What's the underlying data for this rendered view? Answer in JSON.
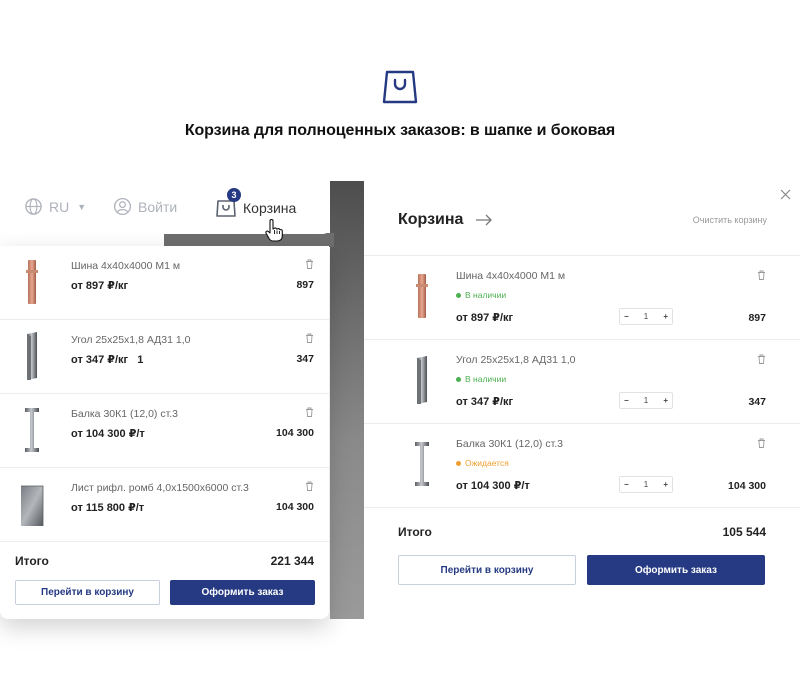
{
  "hero": {
    "icon": "shopping-bag-icon",
    "title": "Корзина для полноценных заказов: в шапке и боковая"
  },
  "colors": {
    "accent": "#253a82",
    "in_stock": "#4caf50",
    "expected": "#f0a030"
  },
  "header": {
    "lang": {
      "icon": "globe-icon",
      "label": "RU"
    },
    "login": {
      "icon": "user-icon",
      "label": "Войти"
    },
    "cart": {
      "icon": "cart-icon",
      "label": "Корзина",
      "badge": "3"
    }
  },
  "mini_cart": {
    "items": [
      {
        "name": "Шина 4х40х4000 М1 м",
        "price": "от 897 ₽/кг",
        "total": "897",
        "thumb": "copper-bar"
      },
      {
        "name": "Угол 25х25х1,8 АД31 1,0",
        "price": "от 347 ₽/кг",
        "qty_note": "1",
        "total": "347",
        "thumb": "angle"
      },
      {
        "name": "Балка 30К1 (12,0) ст.3",
        "price": "от 104 300 ₽/т",
        "total": "104 300",
        "thumb": "beam"
      },
      {
        "name": "Лист рифл. ромб 4,0х1500х6000 ст.3",
        "price": "от 115 800 ₽/т",
        "total": "104 300",
        "thumb": "sheet"
      }
    ],
    "sum_label": "Итого",
    "sum_value": "221 344",
    "btn_cart": "Перейти в корзину",
    "btn_order": "Оформить заказ"
  },
  "side_cart": {
    "title": "Корзина",
    "clear": "Очистить корзину",
    "items": [
      {
        "name": "Шина 4х40х4000 М1 м",
        "status": "В наличии",
        "status_type": "in_stock",
        "price": "от 897 ₽/кг",
        "qty": "1",
        "total": "897"
      },
      {
        "name": "Угол 25х25х1,8 АД31 1,0",
        "status": "В наличии",
        "status_type": "in_stock",
        "price": "от 347 ₽/кг",
        "qty": "1",
        "total": "347"
      },
      {
        "name": "Балка 30К1 (12,0) ст.3",
        "status": "Ожидается",
        "status_type": "expected",
        "price": "от 104 300 ₽/т",
        "qty": "1",
        "total": "104 300"
      }
    ],
    "minus": "−",
    "plus": "+",
    "sum_label": "Итого",
    "sum_value": "105 544",
    "btn_cart": "Перейти в корзину",
    "btn_order": "Оформить заказ"
  }
}
